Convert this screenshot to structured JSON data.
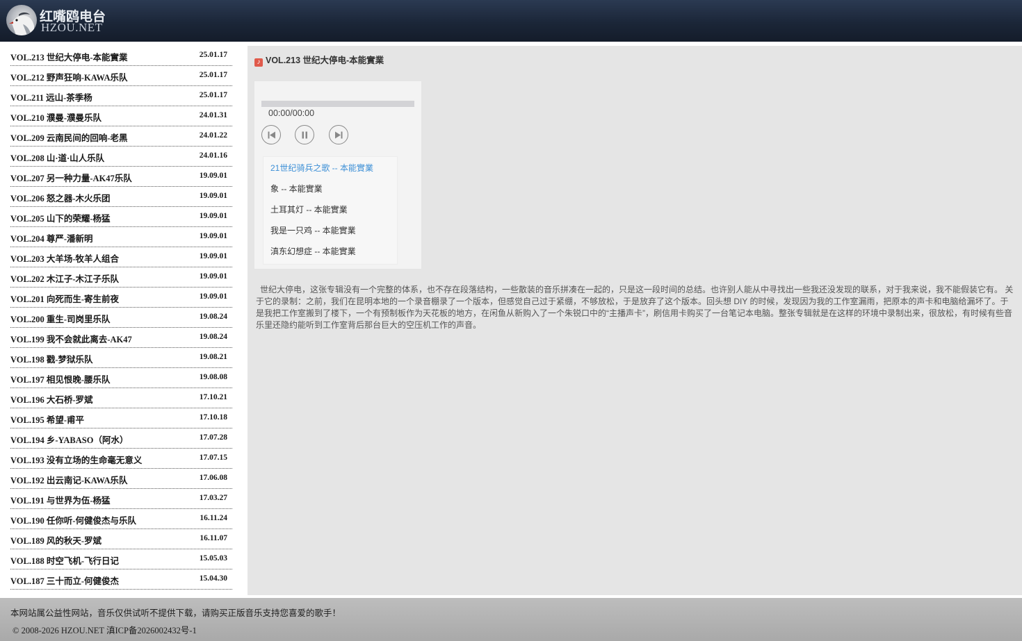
{
  "header": {
    "logo_cn": "红嘴鸥电台",
    "logo_en": "HZOU.NET"
  },
  "sidebar": {
    "items": [
      {
        "title": "VOL.213 世纪大停电-本能實業",
        "date": "25.01.17"
      },
      {
        "title": "VOL.212 野声狂响-KAWA乐队",
        "date": "25.01.17"
      },
      {
        "title": "VOL.211 远山-茶季杨",
        "date": "25.01.17"
      },
      {
        "title": "VOL.210 濮曼-濮曼乐队",
        "date": "24.01.31"
      },
      {
        "title": "VOL.209 云南民间的回响-老黑",
        "date": "24.01.22"
      },
      {
        "title": "VOL.208 山·道·山人乐队",
        "date": "24.01.16"
      },
      {
        "title": "VOL.207 另一种力量-AK47乐队",
        "date": "19.09.01"
      },
      {
        "title": "VOL.206 怒之器-木火乐团",
        "date": "19.09.01"
      },
      {
        "title": "VOL.205 山下的荣耀-杨猛",
        "date": "19.09.01"
      },
      {
        "title": "VOL.204 尊严-潘新明",
        "date": "19.09.01"
      },
      {
        "title": "VOL.203 大羊场-牧羊人组合",
        "date": "19.09.01"
      },
      {
        "title": "VOL.202 木江子-木江子乐队",
        "date": "19.09.01"
      },
      {
        "title": "VOL.201 向死而生-寄生前夜",
        "date": "19.09.01"
      },
      {
        "title": "VOL.200 重生-司岗里乐队",
        "date": "19.08.24"
      },
      {
        "title": "VOL.199 我不会就此离去-AK47",
        "date": "19.08.24"
      },
      {
        "title": "VOL.198 戳-梦狱乐队",
        "date": "19.08.21"
      },
      {
        "title": "VOL.197 相见恨晚-腰乐队",
        "date": "19.08.08"
      },
      {
        "title": "VOL.196 大石桥-罗斌",
        "date": "17.10.21"
      },
      {
        "title": "VOL.195 希望-甫平",
        "date": "17.10.18"
      },
      {
        "title": "VOL.194 乡-YABASO（阿水）",
        "date": "17.07.28"
      },
      {
        "title": "VOL.193 没有立场的生命毫无意义",
        "date": "17.07.15"
      },
      {
        "title": "VOL.192 出云南记-KAWA乐队",
        "date": "17.06.08"
      },
      {
        "title": "VOL.191 与世界为伍-杨猛",
        "date": "17.03.27"
      },
      {
        "title": "VOL.190 任你听-何健俊杰与乐队",
        "date": "16.11.24"
      },
      {
        "title": "VOL.189 风的秋天-罗斌",
        "date": "16.11.07"
      },
      {
        "title": "VOL.188 时空飞机-飞行日记",
        "date": "15.05.03"
      },
      {
        "title": "VOL.187 三十而立-何健俊杰",
        "date": "15.04.30"
      }
    ]
  },
  "main": {
    "heading": "VOL.213 世纪大停电-本能實業",
    "heading_icon": "music-note-icon",
    "player": {
      "time": "00:00/00:00",
      "progress": 0,
      "playlist": [
        {
          "label": "21世纪骑兵之歌 -- 本能實業",
          "active": true
        },
        {
          "label": "象 -- 本能實業",
          "active": false
        },
        {
          "label": "土耳其灯 -- 本能實業",
          "active": false
        },
        {
          "label": "我是一只鸡 -- 本能實業",
          "active": false
        },
        {
          "label": "滇东幻想症 -- 本能實業",
          "active": false
        }
      ]
    },
    "description": "世纪大停电，这张专辑没有一个完整的体系，也不存在段落结构，一些散装的音乐拼凑在一起的，只是这一段时间的总结。也许别人能从中寻找出一些我还没发现的联系，对于我来说，我不能假装它有。 关于它的录制：之前，我们在昆明本地的一个录音棚录了一个版本，但感觉自己过于紧绷，不够放松，于是放弃了这个版本。回头想 DIY 的时候，发现因为我的工作室漏雨，把原本的声卡和电脑给漏坏了。于是我把工作室搬到了楼下，一个有预制板作为天花板的地方，在闲鱼从新购入了一个朱锐口中的“主播声卡”，刷信用卡购买了一台笔记本电脑。整张专辑就是在这样的环境中录制出来，很放松，有时候有些音乐里还隐约能听到工作室背后那台巨大的空压机工作的声音。"
  },
  "footer": {
    "notice": "本网站属公益性网站，音乐仅供试听不提供下载，请购买正版音乐支持您喜爱的歌手！",
    "copyright": "© 2008-2026 HZOU.NET 滇ICP备2026002432号-1"
  },
  "colors": {
    "header_bg": "#1b2638",
    "panel_bg": "#e5e5e5",
    "active_track": "#3c8fd6",
    "footer_bg": "#b3b3b3"
  }
}
